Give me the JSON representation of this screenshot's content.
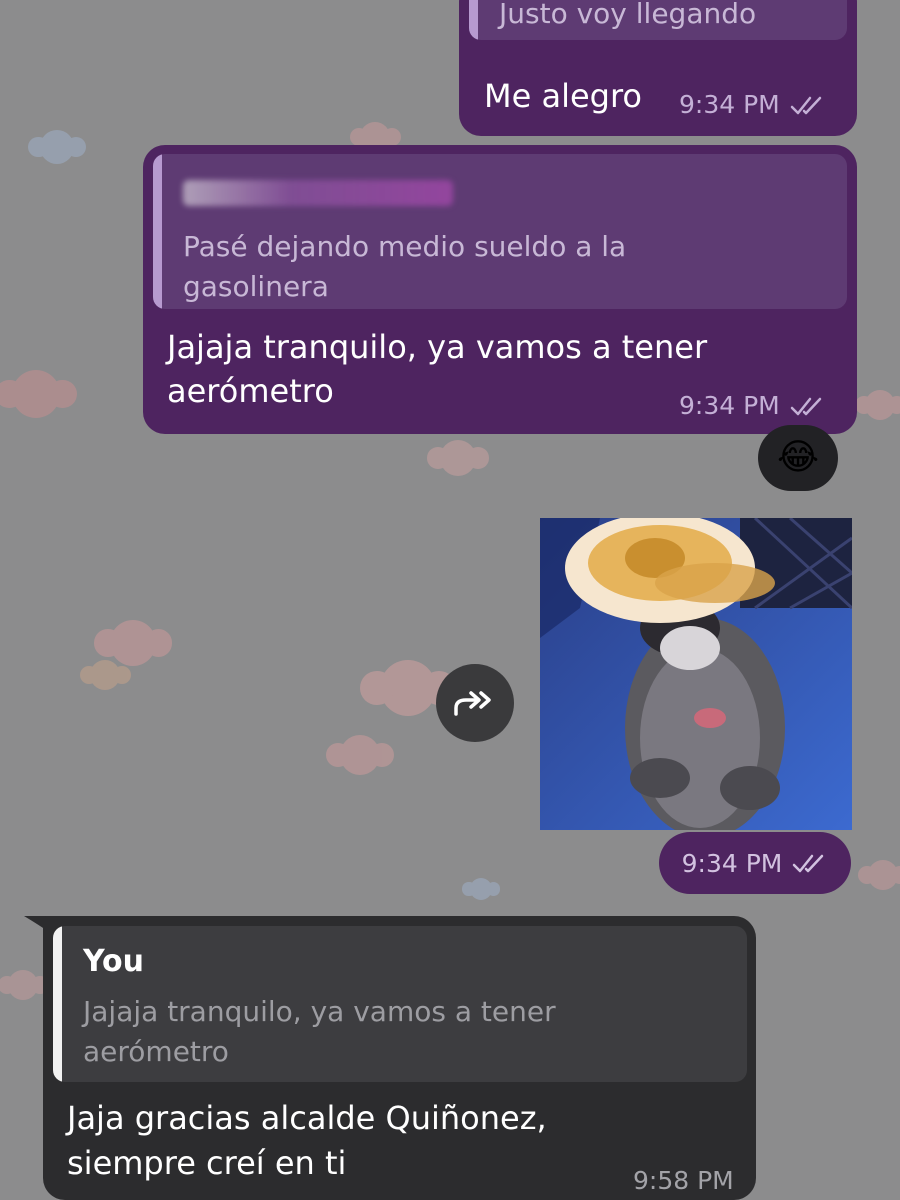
{
  "messages": [
    {
      "direction": "outgoing",
      "reply_preview": {
        "text": "Justo voy llegando"
      },
      "text": "Me alegro",
      "time": "9:34 PM",
      "status": "read"
    },
    {
      "direction": "outgoing",
      "reply_preview": {
        "sender": "redacted",
        "text_line1": "Pasé dejando medio sueldo a la",
        "text_line2": "gasolinera"
      },
      "text_line1": "Jajaja tranquilo, ya vamos a tener",
      "text_line2": "aerómetro",
      "time": "9:34 PM",
      "status": "read",
      "reaction": "😂"
    },
    {
      "direction": "outgoing",
      "type": "gif",
      "media_icon": "raccoon-with-toast-gif",
      "forward_icon": "forward-icon",
      "time": "9:34 PM",
      "status": "read"
    },
    {
      "direction": "incoming",
      "reply_preview": {
        "sender": "You",
        "text_line1": "Jajaja tranquilo, ya vamos a tener",
        "text_line2": "aerómetro"
      },
      "text_line1": "Jaja gracias alcalde Quiñonez,",
      "text_line2": "siempre creí en ti",
      "time": "9:58 PM"
    }
  ],
  "colors": {
    "background": "#8c8c8d",
    "outgoing_bubble": "#4e2460",
    "incoming_bubble": "#2c2c2e",
    "reply_accent_outgoing": "#b79ad0",
    "reply_accent_incoming": "#f2f2f2"
  }
}
